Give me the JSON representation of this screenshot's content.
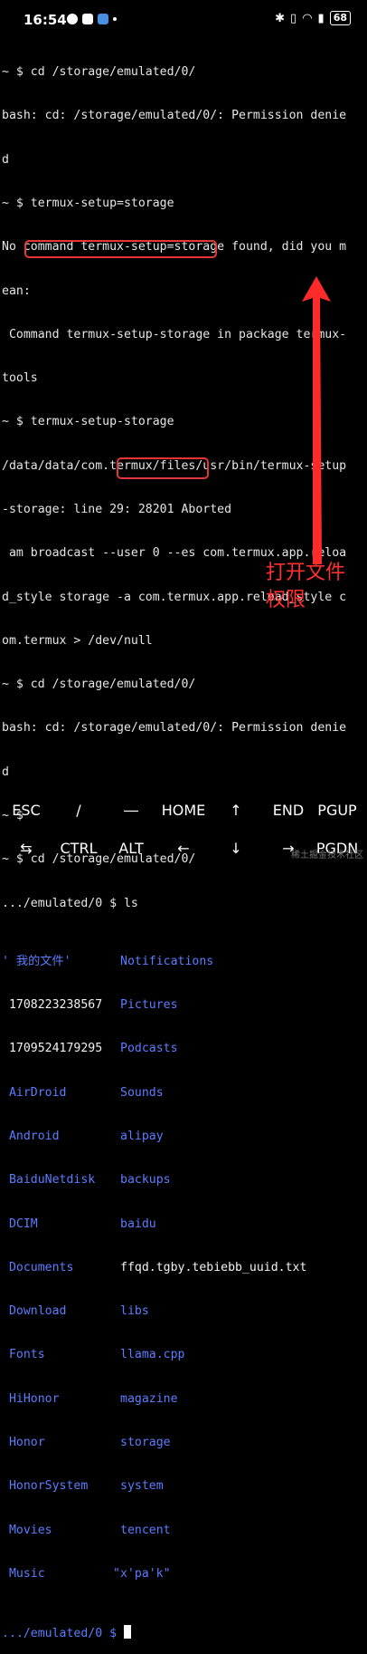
{
  "status_bar": {
    "time": "16:54",
    "battery": "68"
  },
  "terminal": {
    "lines": [
      "~ $ cd /storage/emulated/0/",
      "bash: cd: /storage/emulated/0/: Permission denie",
      "d",
      "~ $ termux-setup=storage",
      "No command termux-setup=storage found, did you m",
      "ean:",
      " Command termux-setup-storage in package termux-",
      "tools",
      "~ $ termux-setup-storage",
      "/data/data/com.termux/files/usr/bin/termux-setup",
      "-storage: line 29: 28201 Aborted",
      " am broadcast --user 0 --es com.termux.app.reloa",
      "d_style storage -a com.termux.app.reload_style c",
      "om.termux > /dev/null",
      "~ $ cd /storage/emulated/0/",
      "bash: cd: /storage/emulated/0/: Permission denie",
      "d",
      "~ $",
      "~ $ cd /storage/emulated/0/",
      ".../emulated/0 $ ls"
    ],
    "ls_rows": [
      [
        "' 我的文件'",
        "Notifications"
      ],
      [
        " 1708223238567",
        "Pictures"
      ],
      [
        " 1709524179295",
        "Podcasts"
      ],
      [
        " AirDroid",
        "Sounds"
      ],
      [
        " Android",
        "alipay"
      ],
      [
        " BaiduNetdisk",
        "backups"
      ],
      [
        " DCIM",
        "baidu"
      ],
      [
        " Documents",
        "ffqd.tgby.tebiebb_uuid.txt"
      ],
      [
        " Download",
        "libs"
      ],
      [
        " Fonts",
        "llama.cpp"
      ],
      [
        " HiHonor",
        "magazine"
      ],
      [
        " Honor",
        "storage"
      ],
      [
        " HonorSystem",
        "system"
      ],
      [
        " Movies",
        "tencent"
      ],
      [
        " Music",
        "\"x'pa'k\""
      ]
    ],
    "prompt": ".../emulated/0 $ "
  },
  "annotation": {
    "line1": "打开文件",
    "line2": "权限"
  },
  "extra_keys": {
    "row1": [
      "ESC",
      "/",
      "―",
      "HOME",
      "↑",
      "END",
      "PGUP"
    ],
    "row2": [
      "⇆",
      "CTRL",
      "ALT",
      "←",
      "↓",
      "→",
      "PGDN"
    ]
  },
  "watermark": "稀土掘金技术社区",
  "colors": {
    "dir_blue": "#5b7dff",
    "annotation_red": "#ff3030"
  }
}
